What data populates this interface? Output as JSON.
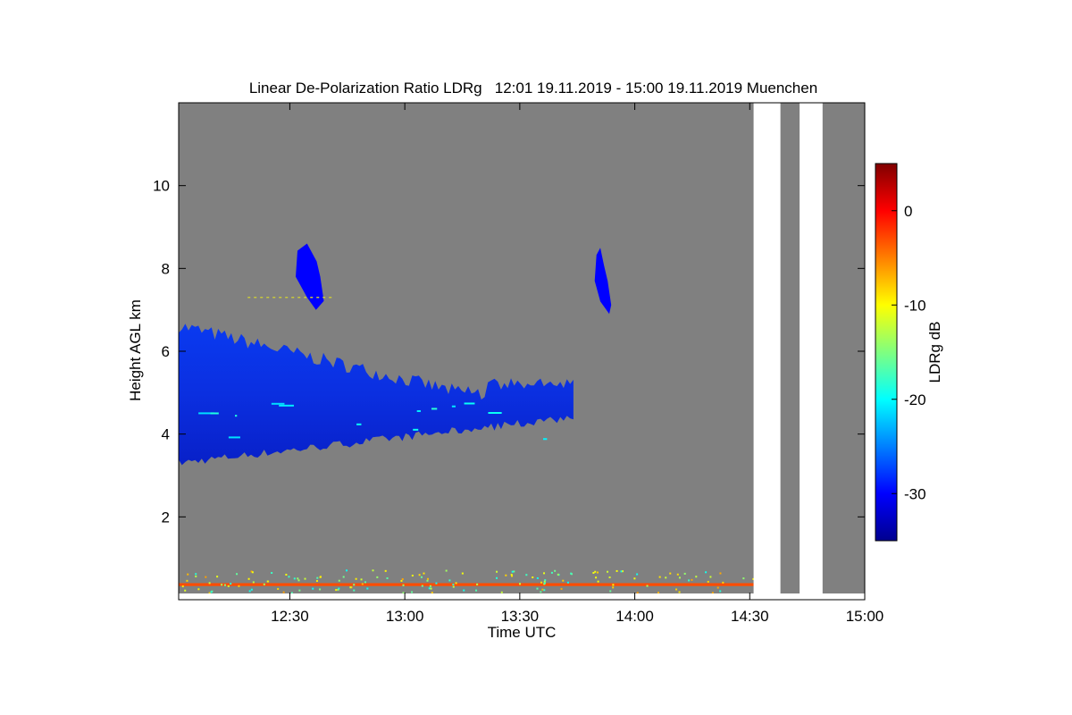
{
  "chart_data": {
    "type": "heatmap",
    "title": "Linear De-Polarization Ratio LDRg   12:01 19.11.2019 - 15:00 19.11.2019 Muenchen",
    "xlabel": "Time UTC",
    "ylabel": "Height AGL km",
    "xlim": [
      "12:01",
      "15:00"
    ],
    "ylim": [
      0,
      12
    ],
    "x_ticks": [
      "12:30",
      "13:00",
      "13:30",
      "14:00",
      "14:30",
      "15:00"
    ],
    "x_tick_minutes": [
      29,
      59,
      89,
      119,
      149,
      179
    ],
    "y_ticks": [
      2,
      4,
      6,
      8,
      10
    ],
    "colorbar": {
      "label": "LDRg dB",
      "range": [
        -35,
        5
      ],
      "ticks": [
        0,
        -10,
        -20,
        -30
      ],
      "colormap": "jet"
    },
    "colors": {
      "no_signal": "#808080",
      "missing_data": "#ffffff"
    },
    "features": {
      "main_cloud": {
        "ldr_db": -30,
        "time_minutes": [
          0,
          103
        ],
        "base_km": [
          3.3,
          4.4
        ],
        "top_km": [
          5.0,
          6.8
        ]
      },
      "cirrus_patches": [
        {
          "time_minutes": [
            31,
            36
          ],
          "height_km": [
            7.0,
            8.6
          ],
          "ldr_db": -30
        },
        {
          "time_minutes": [
            109,
            111
          ],
          "height_km": [
            6.9,
            8.5
          ],
          "ldr_db": -30
        }
      ],
      "near_surface_layer": {
        "height_km": [
          0.33,
          0.4
        ],
        "ldr_db": -3
      },
      "missing_intervals_minutes": [
        [
          150,
          157
        ],
        [
          162,
          168
        ]
      ]
    }
  }
}
